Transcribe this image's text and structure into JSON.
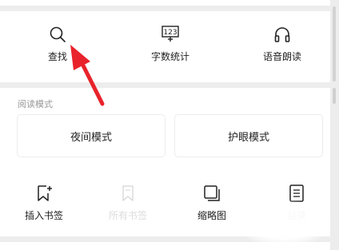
{
  "tools": {
    "find": {
      "label": "查找",
      "icon": "search-icon"
    },
    "word_count": {
      "label": "字数统计",
      "icon": "word-count-icon",
      "icon_text": "123"
    },
    "tts": {
      "label": "语音朗读",
      "icon": "headphones-icon"
    }
  },
  "reading_mode": {
    "section_label": "阅读模式",
    "night_mode": "夜间模式",
    "eye_care_mode": "护眼模式"
  },
  "bottom_tools": {
    "insert_bookmark": {
      "label": "插入书签",
      "icon": "bookmark-add-icon"
    },
    "all_bookmarks": {
      "label": "所有书签",
      "icon": "bookmarks-icon",
      "disabled": true
    },
    "thumbnail": {
      "label": "缩略图",
      "icon": "thumbnail-icon"
    },
    "toc": {
      "label": "目录",
      "icon": "list-icon"
    }
  },
  "annotation": {
    "arrow_color": "#e8232b"
  },
  "colors": {
    "background": "#ededed",
    "panel": "#ffffff",
    "disabled_text": "#dcdcdc"
  }
}
